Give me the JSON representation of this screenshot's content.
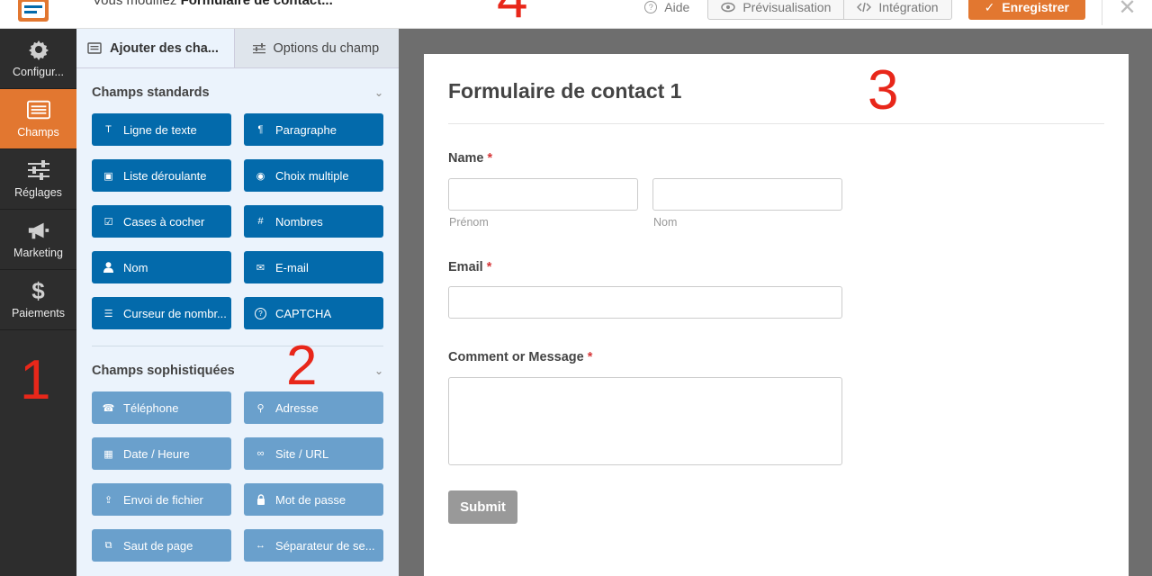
{
  "topbar": {
    "editing_prefix": "Vous modifiez",
    "form_name": "Formulaire de contact...",
    "help_label": "Aide",
    "preview_label": "Prévisualisation",
    "embed_label": "Intégration",
    "save_label": "Enregistrer",
    "close_glyph": "✕"
  },
  "annotations": [
    "1",
    "2",
    "3",
    "4"
  ],
  "leftnav": {
    "items": [
      {
        "label": "Configur...",
        "icon": "gear-icon"
      },
      {
        "label": "Champs",
        "icon": "list-icon",
        "active": true
      },
      {
        "label": "Réglages",
        "icon": "sliders-icon"
      },
      {
        "label": "Marketing",
        "icon": "megaphone-icon"
      },
      {
        "label": "Paiements",
        "icon": "dollar-icon"
      }
    ]
  },
  "panel": {
    "tabs": [
      {
        "label": "Ajouter des cha...",
        "icon": "list-icon"
      },
      {
        "label": "Options du champ",
        "icon": "sliders-icon"
      }
    ],
    "standard": {
      "title": "Champs standards",
      "fields": [
        {
          "label": "Ligne de texte",
          "glyph": "T"
        },
        {
          "label": "Paragraphe",
          "glyph": "¶"
        },
        {
          "label": "Liste déroulante",
          "glyph": "▣"
        },
        {
          "label": "Choix multiple",
          "glyph": "◉"
        },
        {
          "label": "Cases à cocher",
          "glyph": "☑"
        },
        {
          "label": "Nombres",
          "glyph": "#"
        },
        {
          "label": "Nom",
          "glyph": "👤"
        },
        {
          "label": "E-mail",
          "glyph": "✉"
        },
        {
          "label": "Curseur de nombr...",
          "glyph": "☰"
        },
        {
          "label": "CAPTCHA",
          "glyph": "?"
        }
      ]
    },
    "fancy": {
      "title": "Champs sophistiquées",
      "fields": [
        {
          "label": "Téléphone",
          "glyph": "☎"
        },
        {
          "label": "Adresse",
          "glyph": "⚲"
        },
        {
          "label": "Date / Heure",
          "glyph": "▦"
        },
        {
          "label": "Site / URL",
          "glyph": "∞"
        },
        {
          "label": "Envoi de fichier",
          "glyph": "⇪"
        },
        {
          "label": "Mot de passe",
          "glyph": "🔒"
        },
        {
          "label": "Saut de page",
          "glyph": "⧉"
        },
        {
          "label": "Séparateur de se...",
          "glyph": "↔"
        }
      ]
    }
  },
  "form": {
    "title": "Formulaire de contact 1",
    "name_label": "Name",
    "first_sublabel": "Prénom",
    "last_sublabel": "Nom",
    "email_label": "Email",
    "message_label": "Comment or Message",
    "required_mark": "*",
    "submit_label": "Submit"
  },
  "colors": {
    "accent": "#e27730",
    "field_button": "#036aab",
    "field_button_fancy": "#6aa0cc",
    "annotation": "#e8271a"
  }
}
